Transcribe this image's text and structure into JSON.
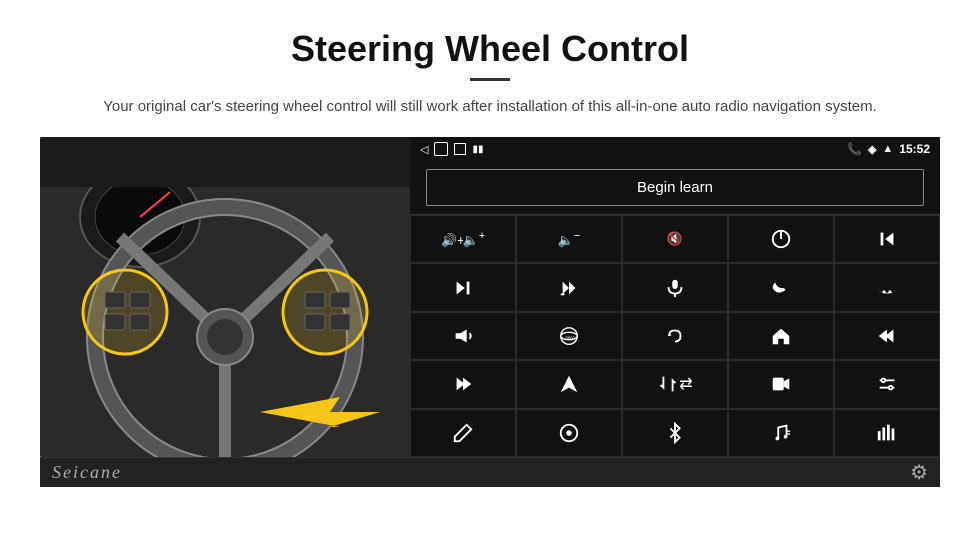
{
  "header": {
    "title": "Steering Wheel Control",
    "divider": true,
    "subtitle": "Your original car's steering wheel control will still work after installation of this all-in-one auto radio navigation system."
  },
  "android_screen": {
    "status_bar": {
      "left_icons": [
        "back-arrow",
        "home-rounded",
        "square-recent"
      ],
      "right_icons": [
        "phone-icon",
        "location-icon",
        "wifi-icon"
      ],
      "time": "15:52"
    },
    "begin_learn_btn": "Begin learn",
    "controls": [
      {
        "icon": "vol-up",
        "unicode": "🔊+"
      },
      {
        "icon": "vol-down",
        "unicode": "🔉-"
      },
      {
        "icon": "vol-mute",
        "unicode": "🔇"
      },
      {
        "icon": "power",
        "unicode": "⏻"
      },
      {
        "icon": "prev-track",
        "unicode": "⏮"
      },
      {
        "icon": "skip-next",
        "unicode": "⏭"
      },
      {
        "icon": "fast-forward-alt",
        "unicode": "⏩"
      },
      {
        "icon": "mic",
        "unicode": "🎙"
      },
      {
        "icon": "phone",
        "unicode": "📞"
      },
      {
        "icon": "hang-up",
        "unicode": "📵"
      },
      {
        "icon": "horn",
        "unicode": "📣"
      },
      {
        "icon": "360-view",
        "unicode": "👁"
      },
      {
        "icon": "undo",
        "unicode": "↩"
      },
      {
        "icon": "home",
        "unicode": "🏠"
      },
      {
        "icon": "skip-back",
        "unicode": "⏮"
      },
      {
        "icon": "skip-fwd",
        "unicode": "⏭"
      },
      {
        "icon": "navigate",
        "unicode": "➤"
      },
      {
        "icon": "swap",
        "unicode": "⇄"
      },
      {
        "icon": "rec",
        "unicode": "⏺"
      },
      {
        "icon": "equalizer",
        "unicode": "🎛"
      },
      {
        "icon": "pen",
        "unicode": "✏"
      },
      {
        "icon": "circle-dot",
        "unicode": "🎯"
      },
      {
        "icon": "bluetooth",
        "unicode": "₿"
      },
      {
        "icon": "music-settings",
        "unicode": "🎵"
      },
      {
        "icon": "audio-bars",
        "unicode": "📊"
      }
    ]
  },
  "watermark": {
    "text": "Seicane",
    "gear_icon": "⚙"
  }
}
